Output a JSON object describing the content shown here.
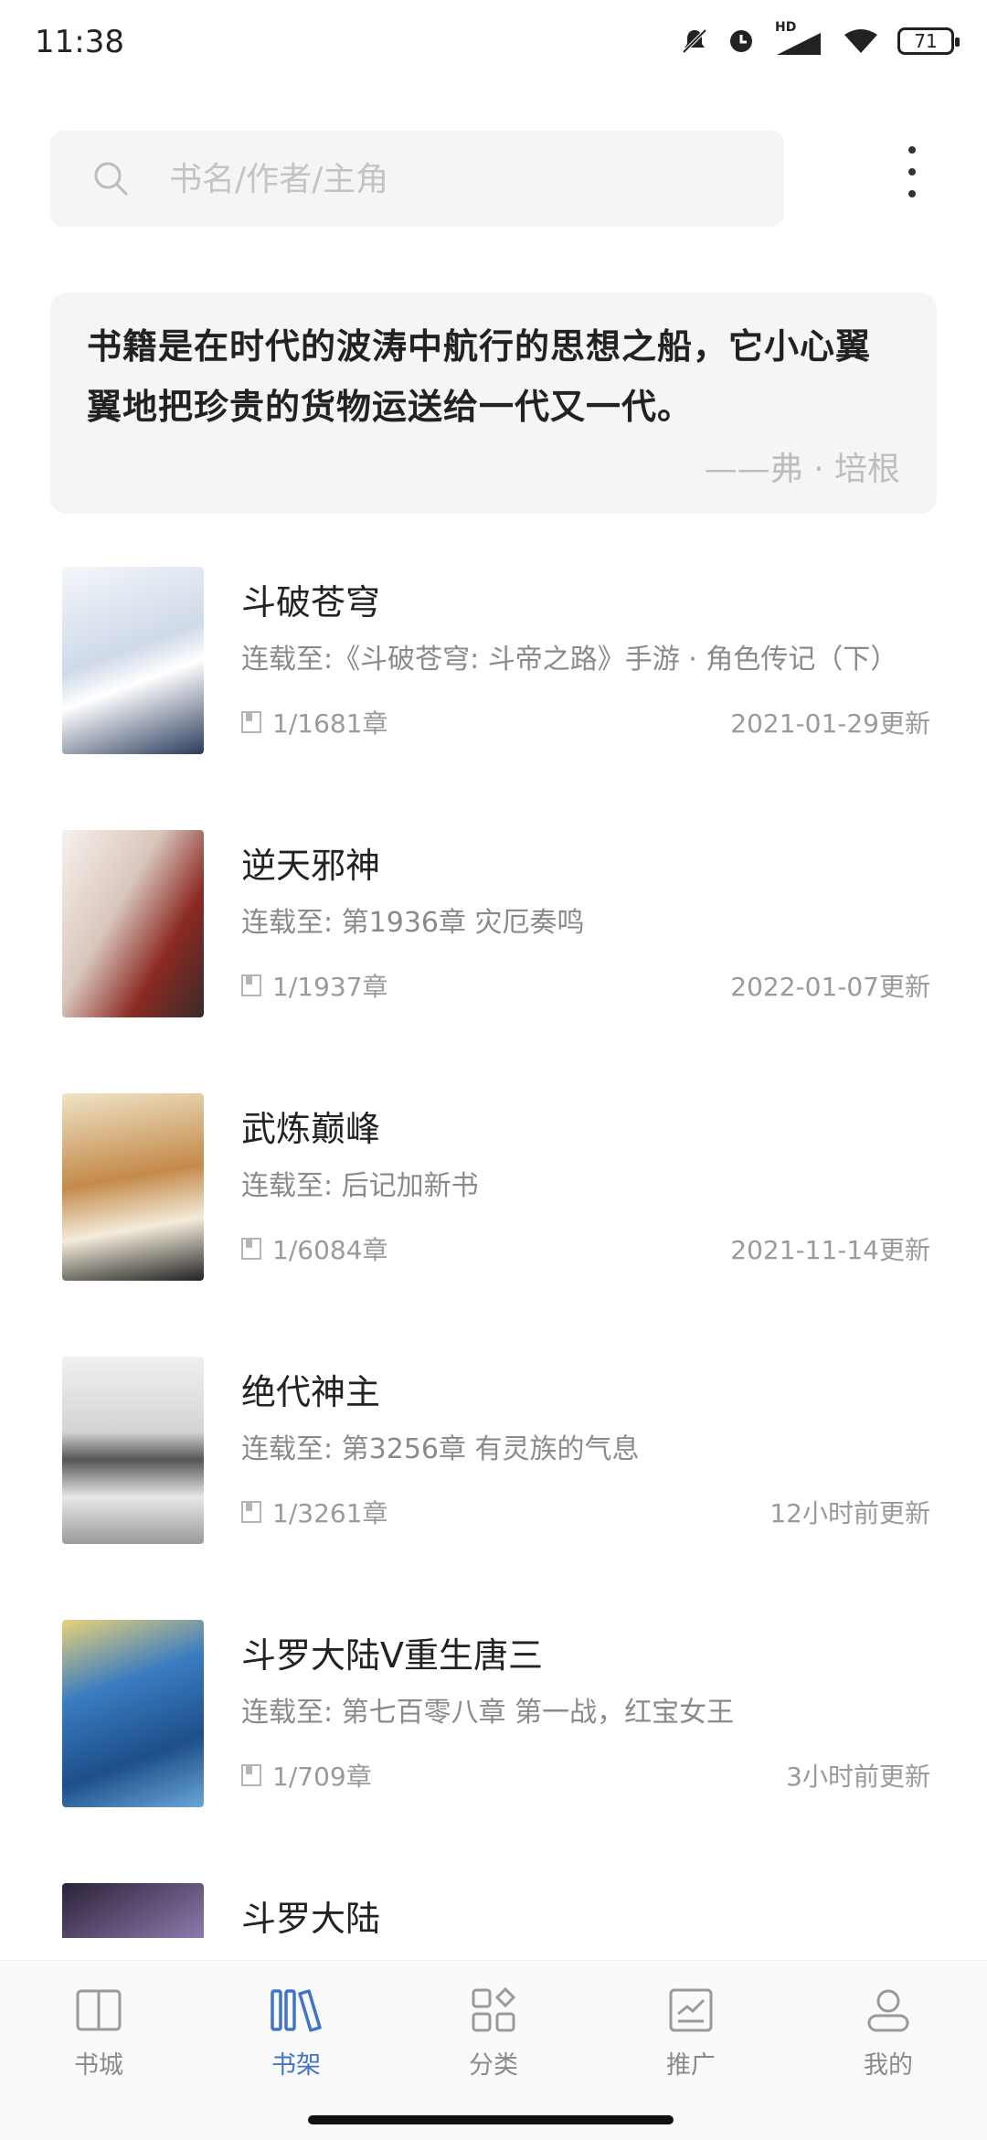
{
  "status_bar": {
    "time": "11:38",
    "battery": "71",
    "network": "HD"
  },
  "search": {
    "placeholder": "书名/作者/主角"
  },
  "quote": {
    "text": "书籍是在时代的波涛中航行的思想之船，它小心翼翼地把珍贵的货物运送给一代又一代。",
    "author": "——弗 · 培根"
  },
  "books": [
    {
      "title": "斗破苍穹",
      "latest": "连载至:《斗破苍穹: 斗帝之路》手游 · 角色传记（下）",
      "progress": "1/1681章",
      "updated": "2021-01-29更新",
      "cover_colors": [
        "#e9eef6",
        "#1b2b4a"
      ]
    },
    {
      "title": "逆天邪神",
      "latest": "连载至: 第1936章 灾厄奏鸣",
      "progress": "1/1937章",
      "updated": "2022-01-07更新",
      "cover_colors": [
        "#f3ece6",
        "#b8261f"
      ]
    },
    {
      "title": "武炼巅峰",
      "latest": "连载至: 后记加新书",
      "progress": "1/6084章",
      "updated": "2021-11-14更新",
      "cover_colors": [
        "#efe6cf",
        "#7a3b1c"
      ]
    },
    {
      "title": "绝代神主",
      "latest": "连载至: 第3256章 有灵族的气息",
      "progress": "1/3261章",
      "updated": "12小时前更新",
      "cover_colors": [
        "#e6e6e6",
        "#3a3a3a"
      ]
    },
    {
      "title": "斗罗大陆V重生唐三",
      "latest": "连载至: 第七百零八章 第一战，红宝女王",
      "progress": "1/709章",
      "updated": "3小时前更新",
      "cover_colors": [
        "#2d6fb2",
        "#d9b441"
      ]
    },
    {
      "title": "斗罗大陆",
      "latest": "",
      "progress": "",
      "updated": "",
      "cover_colors": [
        "#3b2e4a",
        "#9a86b8"
      ]
    }
  ],
  "tabs": [
    {
      "label": "书城",
      "icon": "book-open-icon",
      "active": false
    },
    {
      "label": "书架",
      "icon": "bookshelf-icon",
      "active": true
    },
    {
      "label": "分类",
      "icon": "category-grid-icon",
      "active": false
    },
    {
      "label": "推广",
      "icon": "promote-chart-icon",
      "active": false
    },
    {
      "label": "我的",
      "icon": "profile-icon",
      "active": false
    }
  ],
  "colors": {
    "accent": "#3f74c8",
    "inactive": "#8a8a8a",
    "card_bg": "#f5f5f5"
  }
}
